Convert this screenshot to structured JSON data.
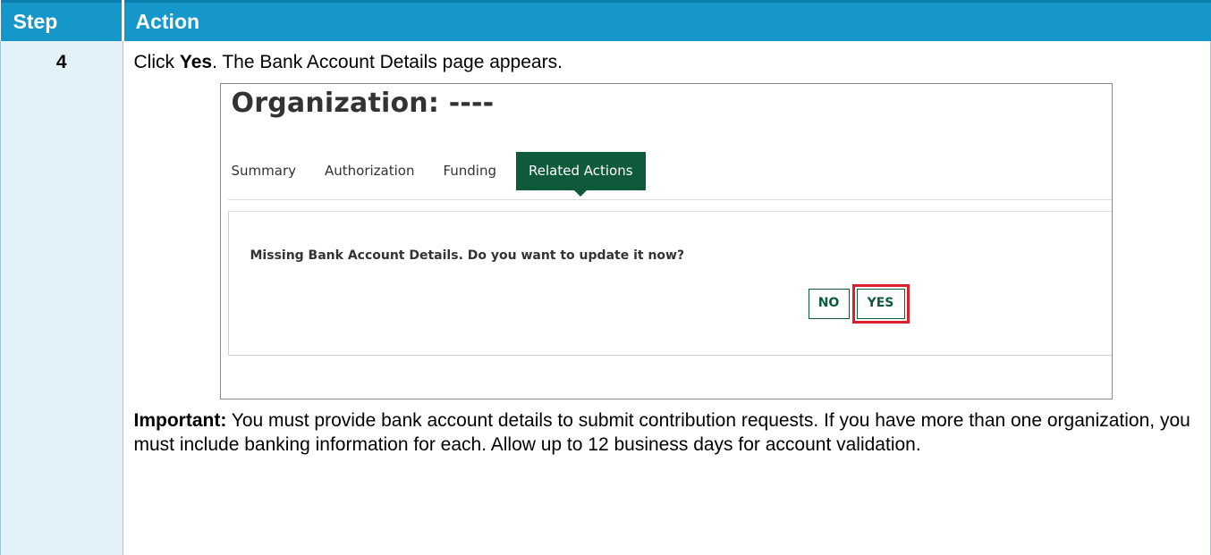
{
  "table": {
    "headers": {
      "step": "Step",
      "action": "Action"
    },
    "row": {
      "step": "4",
      "intro_prefix": "Click ",
      "intro_bold": "Yes",
      "intro_suffix": ". The Bank Account Details page appears.",
      "important_label": "Important:",
      "important_text": " You must provide bank account details to submit contribution requests. If you have more than one organization, you must include banking information for each. Allow up to 12 business days for account validation."
    }
  },
  "screenshot": {
    "title": "Organization: ----",
    "tabs": [
      {
        "label": "Summary",
        "active": false
      },
      {
        "label": "Authorization",
        "active": false
      },
      {
        "label": "Funding",
        "active": false
      },
      {
        "label": "Related Actions",
        "active": true
      }
    ],
    "dialog": {
      "message": "Missing Bank Account Details. Do you want to update it now?",
      "no_label": "NO",
      "yes_label": "YES"
    }
  },
  "colors": {
    "header_bg": "#1597c9",
    "step_bg": "#e3f1f9",
    "brand_green": "#0f5a3a",
    "highlight_red": "#d9202a"
  }
}
